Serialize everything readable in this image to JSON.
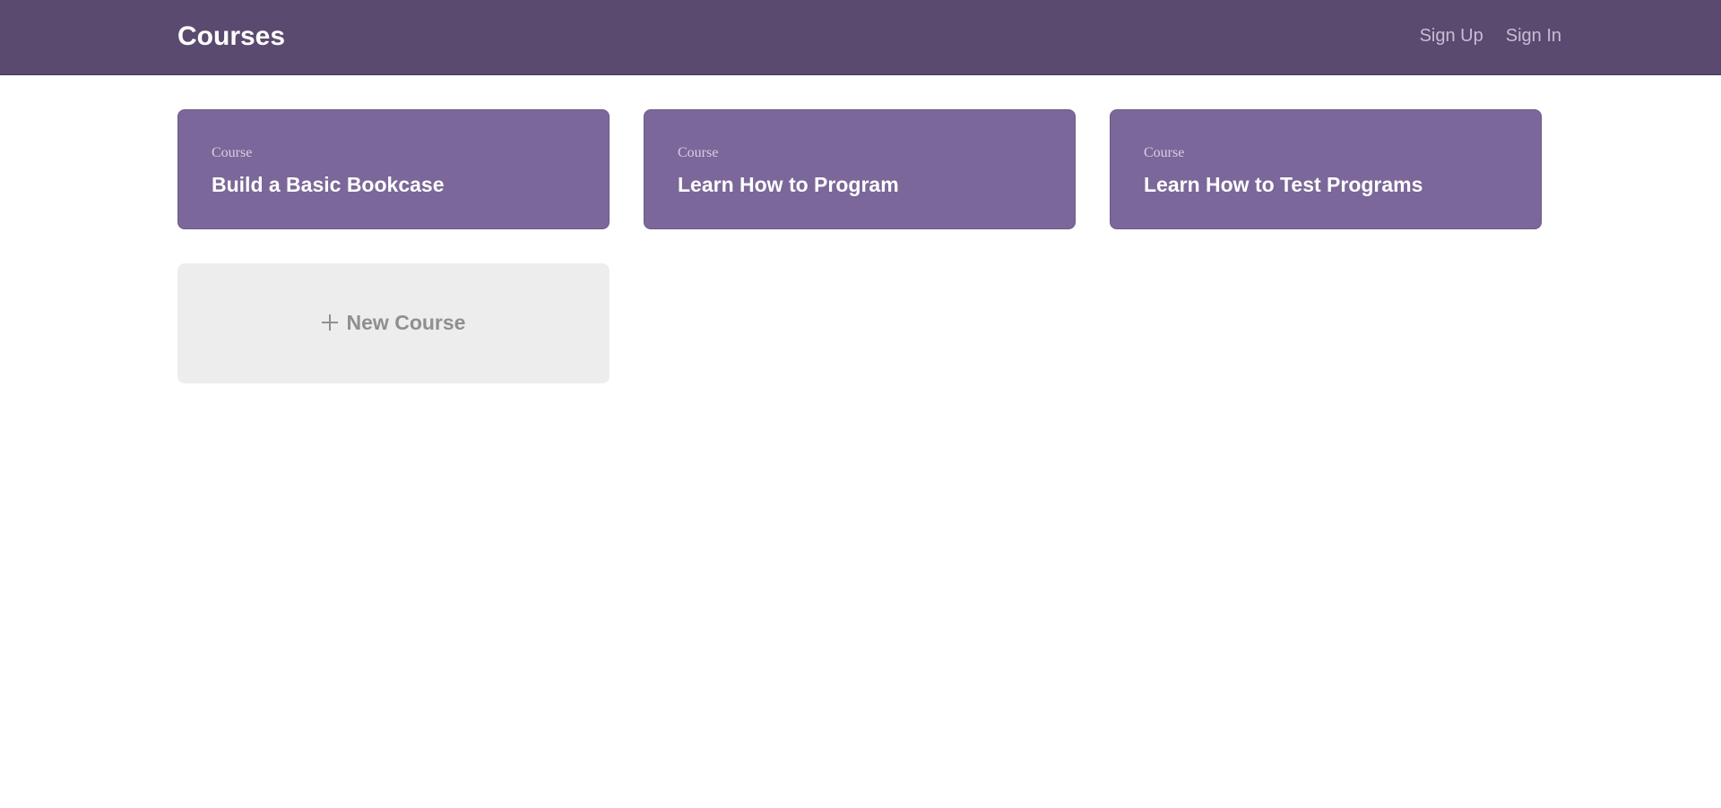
{
  "header": {
    "brand": "Courses",
    "nav": [
      "Sign Up",
      "Sign In"
    ]
  },
  "courses": [
    {
      "label": "Course",
      "title": "Build a Basic Bookcase"
    },
    {
      "label": "Course",
      "title": "Learn How to Program"
    },
    {
      "label": "Course",
      "title": "Learn How to Test Programs"
    }
  ],
  "new_course": {
    "icon": "plus-icon",
    "label": "New Course"
  },
  "colors": {
    "header_bg": "#5a4a6f",
    "card_bg": "#7b6799",
    "new_card_bg": "#ededed"
  }
}
